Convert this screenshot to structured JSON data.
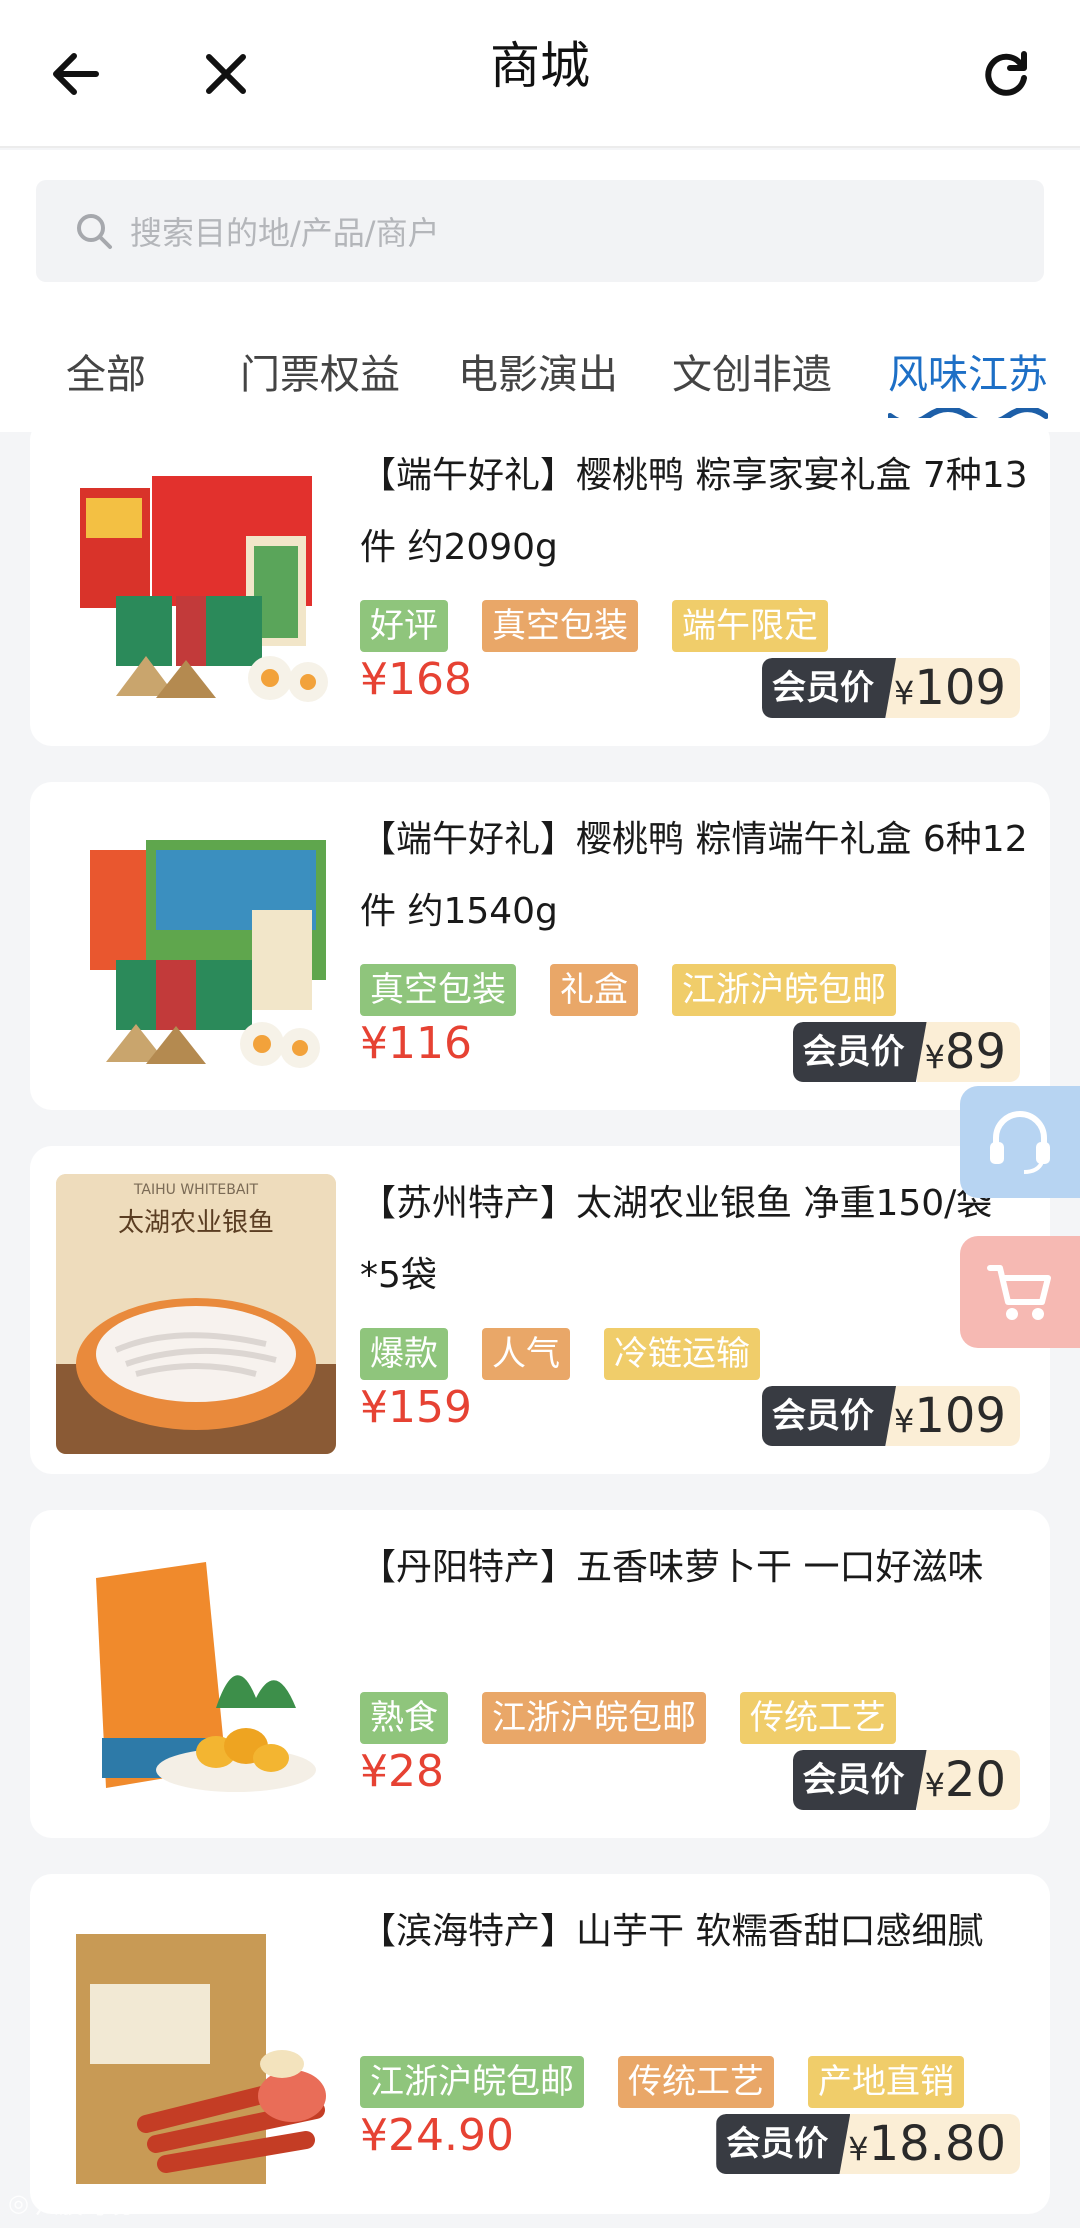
{
  "header": {
    "title": "商城"
  },
  "search": {
    "placeholder": "搜索目的地/产品/商户"
  },
  "tabs": [
    {
      "label": "全部",
      "active": false
    },
    {
      "label": "门票权益",
      "active": false
    },
    {
      "label": "电影演出",
      "active": false
    },
    {
      "label": "文创非遗",
      "active": false
    },
    {
      "label": "风味江苏",
      "active": true
    }
  ],
  "member_label": "会员价",
  "currency": "¥",
  "products": [
    {
      "name": "【端午好礼】樱桃鸭 粽享家宴礼盒 7种13件 约2090g",
      "tags": [
        {
          "text": "好评",
          "color": "green"
        },
        {
          "text": "真空包装",
          "color": "orange"
        },
        {
          "text": "端午限定",
          "color": "yellow"
        }
      ],
      "price": "¥168",
      "member_price": "109"
    },
    {
      "name": "【端午好礼】樱桃鸭 粽情端午礼盒 6种12件 约1540g",
      "tags": [
        {
          "text": "真空包装",
          "color": "green"
        },
        {
          "text": "礼盒",
          "color": "orange"
        },
        {
          "text": "江浙沪皖包邮",
          "color": "yellow"
        }
      ],
      "price": "¥116",
      "member_price": "89"
    },
    {
      "name": "【苏州特产】太湖农业银鱼 净重150/袋*5袋",
      "image_text": {
        "en": "TAIHU WHITEBAIT",
        "cn": "太湖农业银鱼"
      },
      "tags": [
        {
          "text": "爆款",
          "color": "green"
        },
        {
          "text": "人气",
          "color": "orange"
        },
        {
          "text": "冷链运输",
          "color": "yellow"
        }
      ],
      "price": "¥159",
      "member_price": "109"
    },
    {
      "name": "【丹阳特产】五香味萝卜干 一口好滋味",
      "tags": [
        {
          "text": "熟食",
          "color": "green"
        },
        {
          "text": "江浙沪皖包邮",
          "color": "orange"
        },
        {
          "text": "传统工艺",
          "color": "yellow"
        }
      ],
      "price": "¥28",
      "member_price": "20"
    },
    {
      "name": "【滨海特产】山芋干 软糯香甜口感细腻",
      "tags": [
        {
          "text": "江浙沪皖包邮",
          "color": "green"
        },
        {
          "text": "传统工艺",
          "color": "orange"
        },
        {
          "text": "产地直销",
          "color": "yellow"
        }
      ],
      "price": "¥24.90",
      "member_price": "18.80"
    }
  ],
  "watermark": "六股跨境"
}
